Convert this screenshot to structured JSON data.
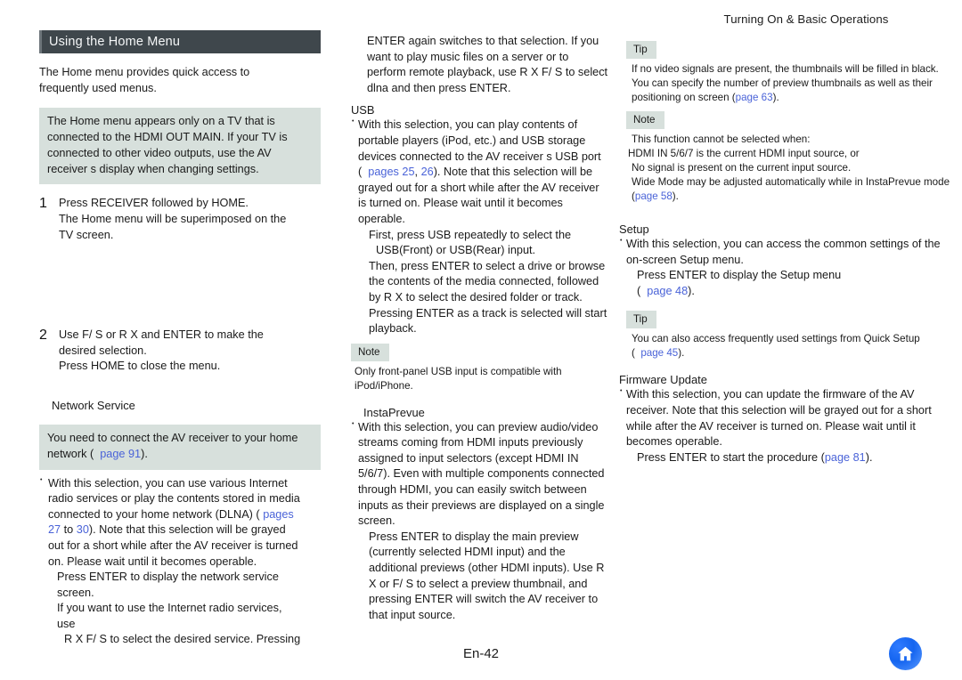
{
  "header": {
    "running_title": "Turning On & Basic Operations"
  },
  "footer": {
    "folio": "En-42",
    "home_icon": "home-icon"
  },
  "colors": {
    "titlebar_bg": "#3f474c",
    "callout_bg": "#d7e0dc",
    "link": "#4a63d8",
    "home_button": "#1565f0"
  },
  "left": {
    "section_title": "Using the Home Menu",
    "intro": "The Home menu provides quick access to frequently used menus.",
    "callout1": "The Home menu appears only on a TV that is connected to the HDMI OUT MAIN. If your TV is connected to other video outputs, use the AV receiver s display when changing settings.",
    "step1": {
      "num": "1",
      "line1": "Press RECEIVER followed by HOME.",
      "line2": "The Home menu will be superimposed on the TV screen."
    },
    "step2": {
      "num": "2",
      "line1": "Use F/ S or R X and ENTER to make the desired selection.",
      "line2": "Press HOME to close the menu."
    },
    "subhead_network": "Network Service",
    "callout2_a": "You need to connect the AV receiver to your home network (",
    "callout2_link": "page 91",
    "callout2_b": ").",
    "bullet_a": "With this selection, you can use various Internet radio services or play the contents stored in media connected to your home network (DLNA) (",
    "bullet_link1": "pages 27",
    "bullet_mid": " to ",
    "bullet_link2": "30",
    "bullet_b": "). Note that this selection will be grayed out for a short while after the AV receiver is turned on. Please wait until it becomes operable.",
    "sub1": "Press ENTER to display the network service screen.",
    "sub2": "If you want to use the Internet radio services, use",
    "sub3": "R X F/ S to select the desired service. Pressing"
  },
  "mid": {
    "cont_para": "ENTER again switches to that selection. If you want to play music files on a server or to perform remote playback, use R X F/ S to select dlna  and then press ENTER.",
    "subhead_usb": "USB",
    "usb_bullet_a": "With this selection, you can play contents of portable players (iPod, etc.) and USB storage devices connected to the AV receiver s USB port (",
    "usb_link1": "pages 25",
    "usb_comma": ", ",
    "usb_link2": "26",
    "usb_bullet_b": "). Note that this selection will be grayed out for a short while after the AV receiver is turned on. Please wait until it becomes operable.",
    "usb_sub1": "First, press USB repeatedly to select the",
    "usb_sub2": "USB(Front)  or  USB(Rear) input.",
    "usb_sub3": "Then, press ENTER to select a drive or browse the contents of the media connected, followed by R X to select the desired folder or track. Pressing ENTER as a track is selected will start playback.",
    "note_label": "Note",
    "note_text": "Only front-panel USB input is compatible with iPod/iPhone.",
    "subhead_insta": "InstaPrevue",
    "insta_bullet": "With this selection, you can preview audio/video streams coming from HDMI inputs previously assigned to input selectors (except HDMI IN 5/6/7). Even with multiple components connected through HDMI, you can easily switch between inputs as their previews are displayed on a single screen.",
    "insta_sub": "Press ENTER to display the main preview (currently selected HDMI input) and the additional previews (other HDMI inputs). Use R X or F/ S to select a preview thumbnail, and pressing ENTER will switch the AV receiver to that input source."
  },
  "right": {
    "tip1_label": "Tip",
    "tip1_line1": "If no video signals are present, the thumbnails will be filled in black.",
    "tip1_line2_a": "You can specify the number of preview thumbnails as well as their positioning on screen (",
    "tip1_link": "page 63",
    "tip1_line2_b": ").",
    "note1_label": "Note",
    "note1_line1": "This function cannot be selected when:",
    "note1_item1": "HDMI IN 5/6/7 is the current HDMI input source, or",
    "note1_item2": "No signal is present on the current input source.",
    "note1_item3_a": "Wide Mode  may be adjusted automatically while in InstaPrevue mode (",
    "note1_link": "page 58",
    "note1_item3_b": ").",
    "subhead_setup": "Setup",
    "setup_bullet": "With this selection, you can access the common settings of the on-screen Setup menu.",
    "setup_sub_a": "Press ENTER to display the Setup menu",
    "setup_sub_b": "(",
    "setup_link": "page 48",
    "setup_sub_c": ").",
    "tip2_label": "Tip",
    "tip2_a": "You can also access frequently used settings from Quick Setup (",
    "tip2_link": "page 45",
    "tip2_b": ").",
    "subhead_firmware": "Firmware Update",
    "firmware_bullet": "With this selection, you can update the firmware of the AV receiver. Note that this selection will be grayed out for a short while after the AV receiver is turned on. Please wait until it becomes operable.",
    "firmware_sub_a": "Press ENTER to start the procedure (",
    "firmware_link": "page 81",
    "firmware_sub_b": ")."
  }
}
